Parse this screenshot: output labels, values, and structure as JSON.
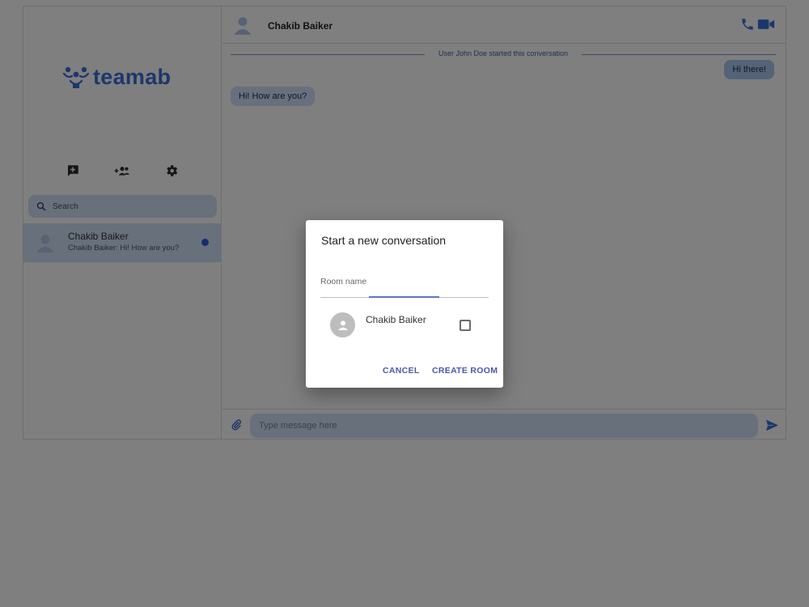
{
  "app": {
    "brand": "teamab"
  },
  "sidebar": {
    "search_placeholder": "Search",
    "conversations": [
      {
        "name": "Chakib Baiker",
        "preview": "Chakib Baiker: Hi! How are you?",
        "unread": true
      }
    ]
  },
  "chat": {
    "contact_name": "Chakib Baiker",
    "system_message": "User John Doe started this conversation",
    "messages": [
      {
        "direction": "outgoing",
        "text": "Hi there!"
      },
      {
        "direction": "incoming",
        "text": "Hi! How are you?"
      }
    ],
    "composer_placeholder": "Type message here"
  },
  "dialog": {
    "title": "Start a new conversation",
    "room_name_label": "Room name",
    "users": [
      {
        "name": "Chakib Baiker",
        "checked": false
      }
    ],
    "cancel_label": "CANCEL",
    "create_label": "CREATE ROOM"
  },
  "colors": {
    "accent": "#3a6fd8",
    "bubble": "#cfe0f7",
    "dialog_button": "#4b57a8"
  }
}
